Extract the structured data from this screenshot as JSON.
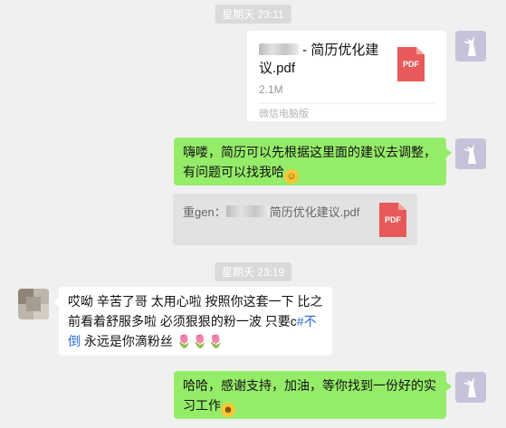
{
  "timestamps": [
    "星期天 23:11",
    "星期天 23:19"
  ],
  "file_card": {
    "name_prefix": "",
    "name_suffix": " - 简历优化建议.pdf",
    "size": "2.1M",
    "source": "微信电脑版",
    "icon_label": "PDF"
  },
  "messages": {
    "m1": "嗨喽，简历可以先根据这里面的建议去调整，有问题可以找我哈",
    "quote_prefix": "重gen：",
    "quote_suffix": "简历优化建议.pdf",
    "quote_icon_label": "PDF",
    "m2_part1": "哎呦 辛苦了哥 太用心啦 按照你这套一下 比之前看着舒服多啦 必须狠狠的粉一波 只要c",
    "m2_hash": "#不倒",
    "m2_part2": " 永远是你滴粉丝",
    "m3": "哈哈，感谢支持，加油，等你找到一份好的实习工作"
  },
  "icons": {
    "pdf": "pdf-file-icon",
    "smile": "smile-emoji",
    "tulip": "tulip-emoji",
    "cheer": "cheer-emoji"
  }
}
